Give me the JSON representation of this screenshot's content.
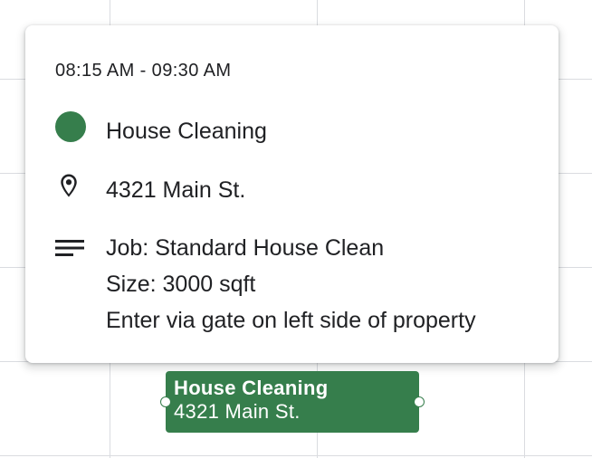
{
  "popover": {
    "time_range": "08:15 AM - 09:30 AM",
    "title": "House Cleaning",
    "title_icon": "green-dot",
    "location": "4321 Main St.",
    "location_icon": "location-pin-icon",
    "notes_icon": "notes-lines-icon",
    "notes": [
      "Job: Standard House Clean",
      "Size: 3000 sqft",
      "Enter via gate on left side of property"
    ]
  },
  "event_chip": {
    "title": "House Cleaning",
    "subtitle": "4321 Main St."
  },
  "colors": {
    "event": "#367e4c",
    "grid": "#dadce0"
  }
}
